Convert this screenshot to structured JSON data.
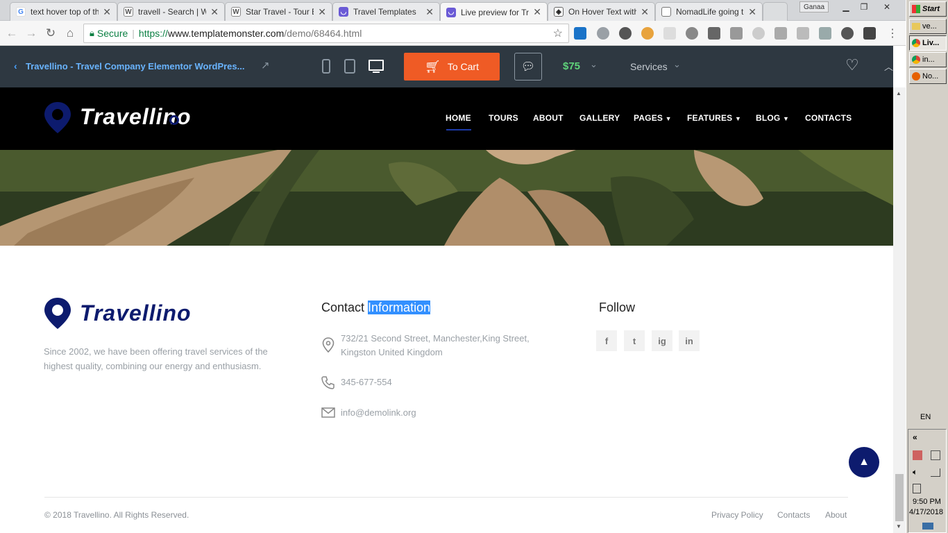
{
  "browser": {
    "tabs": [
      {
        "title": "text hover top of th",
        "favicon": "google-icon"
      },
      {
        "title": "travell - Search | W",
        "favicon": "wordpress-icon"
      },
      {
        "title": "Star Travel - Tour E",
        "favicon": "wordpress-icon"
      },
      {
        "title": "Travel Templates",
        "favicon": "templatemonster-icon"
      },
      {
        "title": "Live preview for Tr",
        "favicon": "templatemonster-icon"
      },
      {
        "title": "On Hover Text with",
        "favicon": "codepen-icon"
      },
      {
        "title": "NomadLife going to",
        "favicon": "page-icon"
      }
    ],
    "user": "Ganaa",
    "secure_label": "Secure",
    "url_prefix": "https://",
    "url_host": "www.templatemonster.com",
    "url_path": "/demo/68464.html"
  },
  "tm_bar": {
    "product_title": "Travellino - Travel Company Elementor WordPres...",
    "cart_label": "To Cart",
    "price": "$75",
    "services_label": "Services"
  },
  "site": {
    "logo_text": "Travellino",
    "nav": [
      {
        "label": "HOME",
        "active": true
      },
      {
        "label": "TOURS"
      },
      {
        "label": "ABOUT"
      },
      {
        "label": "GALLERY"
      },
      {
        "label": "PAGES",
        "dropdown": true
      },
      {
        "label": "FEATURES",
        "dropdown": true
      },
      {
        "label": "BLOG",
        "dropdown": true
      },
      {
        "label": "CONTACTS"
      }
    ]
  },
  "footer": {
    "logo_text": "Travellino",
    "about": "Since 2002, we have been offering travel services of the highest quality, combining our energy and enthusiasm.",
    "contact_heading_plain": "Contact ",
    "contact_heading_selected": "Information",
    "address_line1": "732/21 Second Street, Manchester,King Street,",
    "address_line2": "Kingston United Kingdom",
    "phone": "345-677-554",
    "email": "info@demolink.org",
    "follow_heading": "Follow",
    "social": [
      "f",
      "t",
      "ig",
      "in"
    ],
    "copyright": "© 2018 Travellino. All Rights Reserved.",
    "links": [
      "Privacy Policy",
      "Contacts",
      "About"
    ]
  },
  "taskbar": {
    "start_label": "Start",
    "items": [
      {
        "label": "ve...",
        "icon": "folder-icon"
      },
      {
        "label": "Liv...",
        "icon": "chrome-icon",
        "active": true
      },
      {
        "label": "in...",
        "icon": "chrome-icon"
      },
      {
        "label": "No...",
        "icon": "firefox-icon"
      }
    ],
    "lang": "EN",
    "time": "9:50 PM",
    "date": "4/17/2018"
  },
  "colors": {
    "accent_orange": "#ef5b25",
    "price_green": "#5fd37a",
    "brand_navy": "#0d1b6e",
    "nav_underline": "#1c3aa9",
    "selection": "#3390ff"
  }
}
